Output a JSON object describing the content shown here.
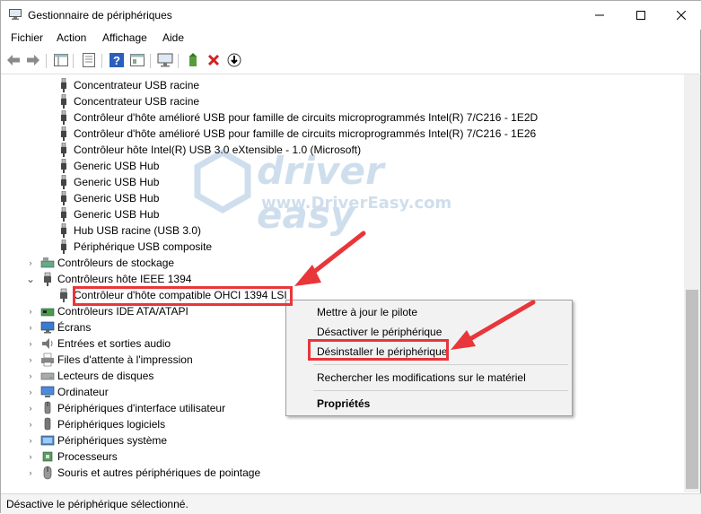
{
  "window": {
    "title": "Gestionnaire de périphériques"
  },
  "menu": [
    "Fichier",
    "Action",
    "Affichage",
    "Aide"
  ],
  "tree": {
    "items": [
      {
        "label": "Concentrateur USB racine",
        "icon": "usb-plug-icon"
      },
      {
        "label": "Concentrateur USB racine",
        "icon": "usb-plug-icon"
      },
      {
        "label": "Contrôleur d'hôte amélioré USB pour famille de circuits microprogrammés Intel(R) 7/C216 - 1E2D",
        "icon": "usb-plug-icon"
      },
      {
        "label": "Contrôleur d'hôte amélioré USB pour famille de circuits microprogrammés Intel(R) 7/C216 - 1E26",
        "icon": "usb-plug-icon"
      },
      {
        "label": "Contrôleur hôte Intel(R) USB 3.0 eXtensible - 1.0 (Microsoft)",
        "icon": "usb-plug-icon"
      },
      {
        "label": "Generic USB Hub",
        "icon": "usb-plug-icon"
      },
      {
        "label": "Generic USB Hub",
        "icon": "usb-plug-icon"
      },
      {
        "label": "Generic USB Hub",
        "icon": "usb-plug-icon"
      },
      {
        "label": "Generic USB Hub",
        "icon": "usb-plug-icon"
      },
      {
        "label": "Hub USB racine (USB 3.0)",
        "icon": "usb-plug-icon"
      },
      {
        "label": "Périphérique USB composite",
        "icon": "usb-plug-icon"
      }
    ],
    "categories_top": [
      {
        "label": "Contrôleurs de stockage",
        "icon": "storage-controller-icon",
        "expanded": false
      },
      {
        "label": "Contrôleurs hôte IEEE 1394",
        "icon": "ieee1394-icon",
        "expanded": true
      }
    ],
    "selected_device": "Contrôleur d'hôte compatible OHCI 1394 LSI",
    "categories_bottom": [
      {
        "label": "Contrôleurs IDE ATA/ATAPI",
        "icon": "ide-controller-icon"
      },
      {
        "label": "Écrans",
        "icon": "monitor-icon"
      },
      {
        "label": "Entrées et sorties audio",
        "icon": "speaker-icon"
      },
      {
        "label": "Files d'attente à l'impression",
        "icon": "printer-icon"
      },
      {
        "label": "Lecteurs de disques",
        "icon": "disk-drive-icon"
      },
      {
        "label": "Ordinateur",
        "icon": "computer-icon"
      },
      {
        "label": "Périphériques d'interface utilisateur",
        "icon": "hid-icon"
      },
      {
        "label": "Périphériques logiciels",
        "icon": "software-device-icon"
      },
      {
        "label": "Périphériques système",
        "icon": "system-device-icon"
      },
      {
        "label": "Processeurs",
        "icon": "processor-icon"
      },
      {
        "label": "Souris et autres périphériques de pointage",
        "icon": "mouse-icon"
      }
    ]
  },
  "context_menu": {
    "update": "Mettre à jour le pilote",
    "disable": "Désactiver le périphérique",
    "uninstall": "Désinstaller le périphérique",
    "scan": "Rechercher les modifications sur le matériel",
    "properties": "Propriétés"
  },
  "status": "Désactive le périphérique sélectionné.",
  "watermark": {
    "main": "driver easy",
    "sub": "www.DriverEasy.com"
  },
  "colors": {
    "annotation": "#e8363a",
    "watermark": "#2a6fb0"
  }
}
